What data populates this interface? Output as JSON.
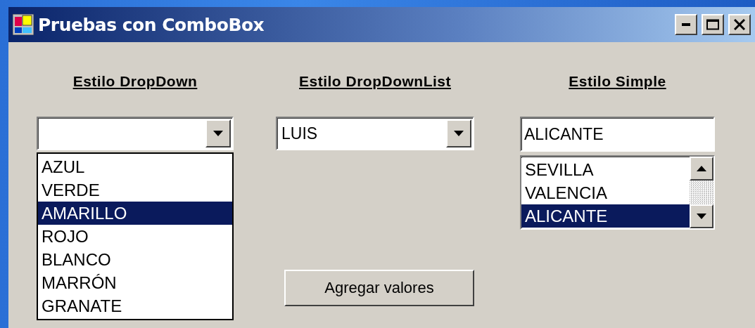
{
  "window": {
    "title": "Pruebas con ComboBox"
  },
  "combos": [
    {
      "kind": "dropdown",
      "heading": "Estilo DropDown",
      "items": [
        {
          "label": "AZUL",
          "selected": false
        },
        {
          "label": "VERDE",
          "selected": false
        },
        {
          "label": "AMARILLO",
          "selected": true
        },
        {
          "label": "ROJO",
          "selected": false
        },
        {
          "label": "BLANCO",
          "selected": false
        },
        {
          "label": "MARRÓN",
          "selected": false
        },
        {
          "label": "GRANATE",
          "selected": false
        }
      ]
    },
    {
      "kind": "dropdownlist",
      "heading": "Estilo DropDownList",
      "value": "LUIS"
    },
    {
      "kind": "simple",
      "heading": "Estilo Simple",
      "value": "ALICANTE",
      "items": [
        {
          "label": "SEVILLA",
          "selected": false
        },
        {
          "label": "VALENCIA",
          "selected": false
        },
        {
          "label": "ALICANTE",
          "selected": true
        }
      ]
    }
  ],
  "button": {
    "label": "Agregar valores"
  }
}
